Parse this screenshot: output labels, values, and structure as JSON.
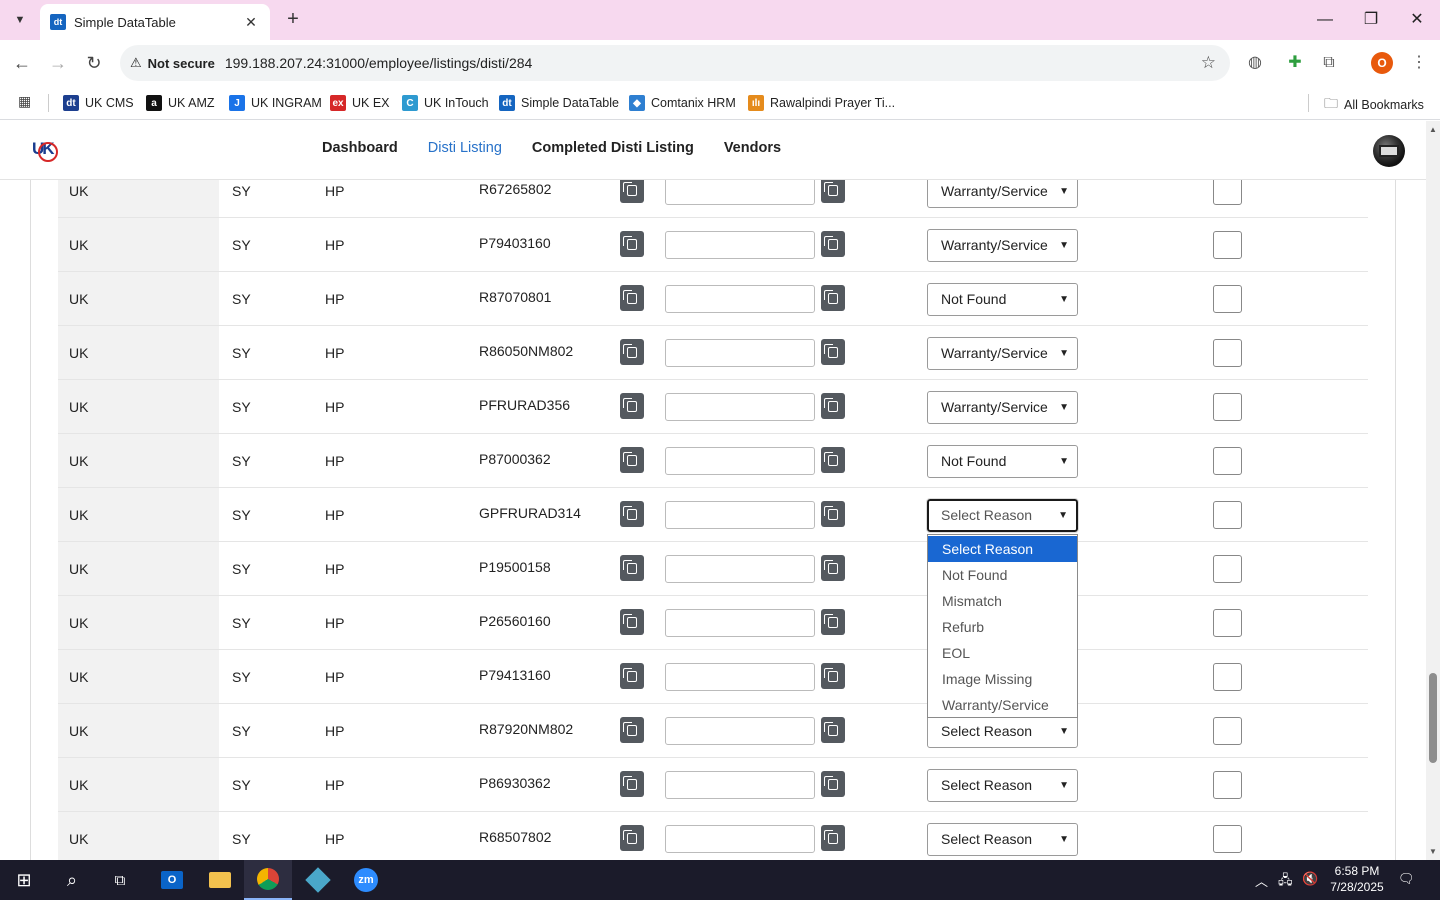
{
  "browser": {
    "tab_title": "Simple DataTable",
    "tab_favicon": "dt",
    "security_label": "Not secure",
    "url": "199.188.207.24:31000/employee/listings/disti/284",
    "profile_initial": "O",
    "bookmarks": [
      {
        "label": "UK CMS",
        "icon": "dt",
        "color": "#1d3f8f"
      },
      {
        "label": "UK AMZ",
        "icon": "a",
        "color": "#111111"
      },
      {
        "label": "UK INGRAM",
        "icon": "J",
        "color": "#1a73e8"
      },
      {
        "label": "UK EX",
        "icon": "ex",
        "color": "#d62828"
      },
      {
        "label": "UK InTouch",
        "icon": "C",
        "color": "#2e9ad0"
      },
      {
        "label": "Simple DataTable",
        "icon": "dt",
        "color": "#1565c0"
      },
      {
        "label": "Comtanix HRM",
        "icon": "◆",
        "color": "#2e7fd1"
      },
      {
        "label": "Rawalpindi Prayer Ti...",
        "icon": "ılı",
        "color": "#e58b1c"
      }
    ],
    "all_bookmarks": "All Bookmarks"
  },
  "nav": {
    "links": [
      "Dashboard",
      "Disti Listing",
      "Completed Disti Listing",
      "Vendors"
    ],
    "active": "Disti Listing"
  },
  "rows": [
    {
      "region": "UK",
      "code": "SY",
      "brand": "HP",
      "part": "R67265802",
      "reason": "Warranty/Service"
    },
    {
      "region": "UK",
      "code": "SY",
      "brand": "HP",
      "part": "P79403160",
      "reason": "Warranty/Service"
    },
    {
      "region": "UK",
      "code": "SY",
      "brand": "HP",
      "part": "R87070801",
      "reason": "Not Found"
    },
    {
      "region": "UK",
      "code": "SY",
      "brand": "HP",
      "part": "R86050NM802",
      "reason": "Warranty/Service"
    },
    {
      "region": "UK",
      "code": "SY",
      "brand": "HP",
      "part": "PFRURAD356",
      "reason": "Warranty/Service"
    },
    {
      "region": "UK",
      "code": "SY",
      "brand": "HP",
      "part": "P87000362",
      "reason": "Not Found"
    },
    {
      "region": "UK",
      "code": "SY",
      "brand": "HP",
      "part": "GPFRURAD314",
      "reason": "Select Reason",
      "open": true
    },
    {
      "region": "UK",
      "code": "SY",
      "brand": "HP",
      "part": "P19500158",
      "reason": ""
    },
    {
      "region": "UK",
      "code": "SY",
      "brand": "HP",
      "part": "P26560160",
      "reason": ""
    },
    {
      "region": "UK",
      "code": "SY",
      "brand": "HP",
      "part": "P79413160",
      "reason": ""
    },
    {
      "region": "UK",
      "code": "SY",
      "brand": "HP",
      "part": "R87920NM802",
      "reason": "Select Reason"
    },
    {
      "region": "UK",
      "code": "SY",
      "brand": "HP",
      "part": "P86930362",
      "reason": "Select Reason"
    },
    {
      "region": "UK",
      "code": "SY",
      "brand": "HP",
      "part": "R68507802",
      "reason": "Select Reason"
    }
  ],
  "dropdown_options": [
    "Select Reason",
    "Not Found",
    "Mismatch",
    "Refurb",
    "EOL",
    "Image Missing",
    "Warranty/Service"
  ],
  "dropdown_selected": "Select Reason",
  "taskbar": {
    "time": "6:58 PM",
    "date": "7/28/2025"
  }
}
